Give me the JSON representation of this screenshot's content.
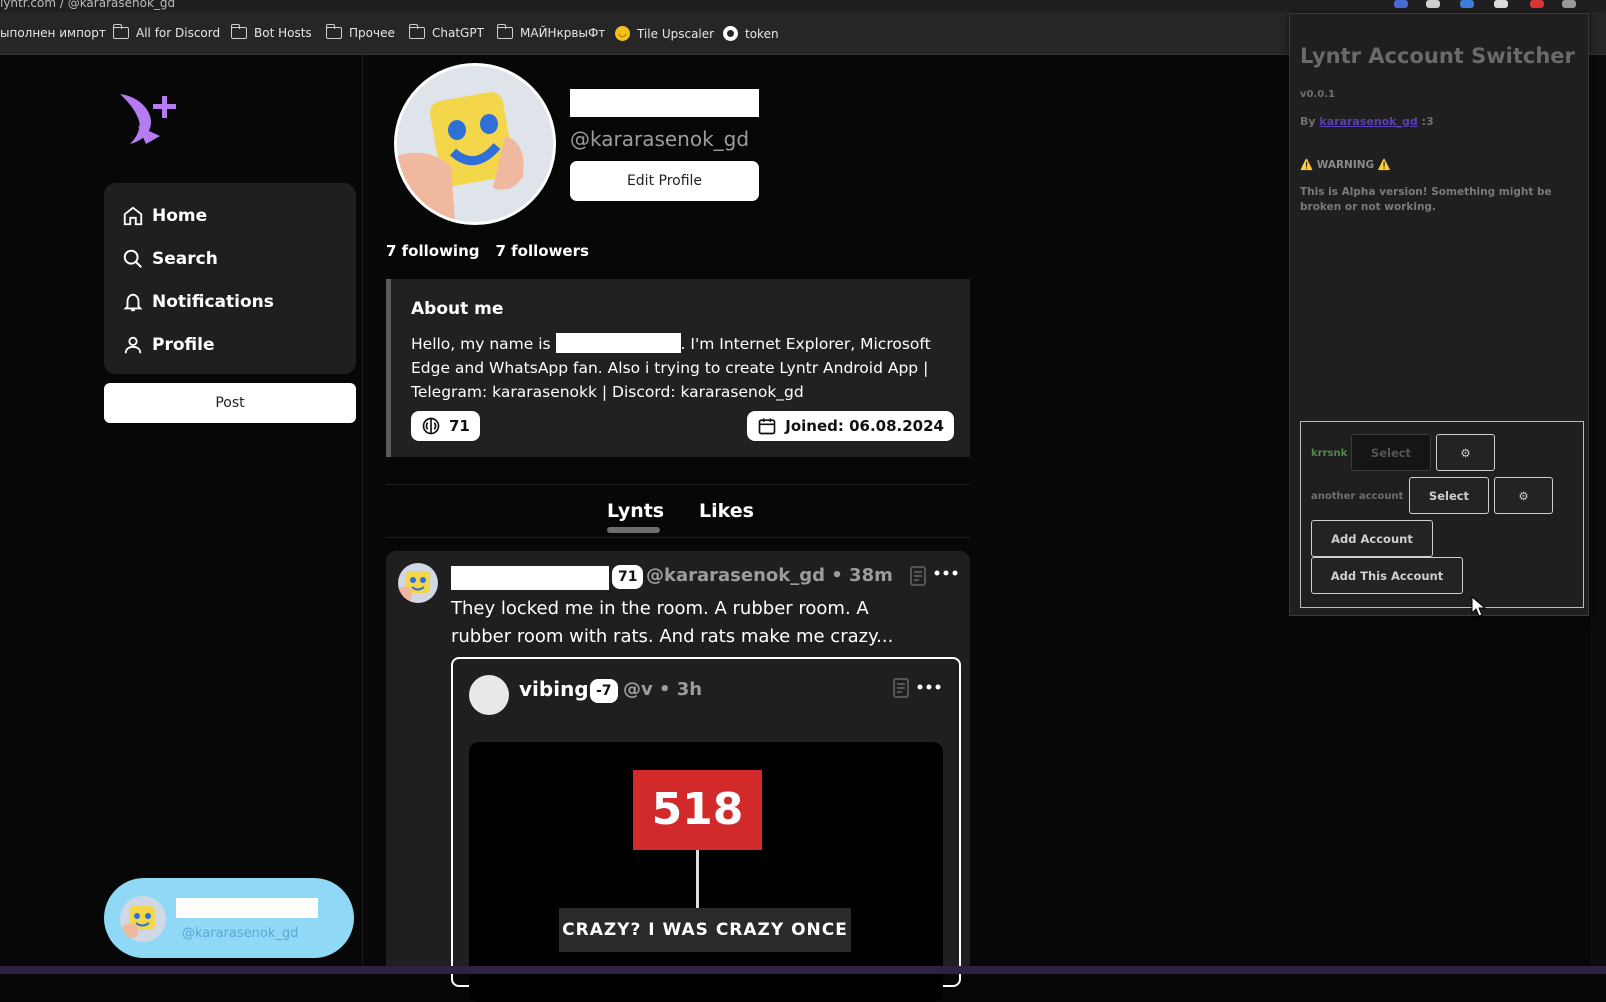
{
  "browser": {
    "tab_title": "lyntr.com / @kararasenok_gd",
    "bookmarks": [
      {
        "label": "ыполнен импорт",
        "icon": "none"
      },
      {
        "label": "All for Discord",
        "icon": "folder-icon"
      },
      {
        "label": "Bot Hosts",
        "icon": "folder-icon"
      },
      {
        "label": "Прочее",
        "icon": "folder-icon"
      },
      {
        "label": "ChatGPT",
        "icon": "folder-icon"
      },
      {
        "label": "МАЙНкрвыФт",
        "icon": "folder-icon"
      },
      {
        "label": "Tile Upscaler",
        "icon": "emoji-icon"
      },
      {
        "label": "token",
        "icon": "globe-icon"
      }
    ]
  },
  "sidebar": {
    "nav": [
      {
        "label": "Home",
        "icon": "home-icon"
      },
      {
        "label": "Search",
        "icon": "search-icon"
      },
      {
        "label": "Notifications",
        "icon": "bell-icon"
      },
      {
        "label": "Profile",
        "icon": "user-icon"
      }
    ],
    "post_label": "Post",
    "account_handle": "@kararasenok_gd"
  },
  "profile": {
    "handle": "@kararasenok_gd",
    "edit_label": "Edit Profile",
    "following": "7 following",
    "followers": "7 followers",
    "about_title": "About me",
    "about_prefix": "Hello, my name is",
    "about_suffix": ". I'm Internet Explorer, Microsoft Edge and WhatsApp fan. Also i trying to create Lyntr Android App | Telegram: kararasenokk | Discord: kararasenok_gd",
    "aura": "71",
    "joined": "Joined: 06.08.2024"
  },
  "tabs": [
    {
      "label": "Lynts",
      "active": true
    },
    {
      "label": "Likes",
      "active": false
    }
  ],
  "post": {
    "aura": "71",
    "meta": "@kararasenok_gd • 38m",
    "text": "They locked me in the room. A rubber room. A rubber room with rats. And rats make me crazy...",
    "quote": {
      "name": "vibing",
      "aura": "-7",
      "meta": "@v • 3h",
      "meme_number": "518",
      "meme_caption": "CRAZY? I WAS CRAZY ONCE"
    }
  },
  "extension": {
    "title": "Lyntr Account Switcher",
    "version": "v0.0.1",
    "by_prefix": "By",
    "author": "kararasenok_gd",
    "by_suffix": ":3",
    "warning": "⚠️ WARNING ⚠️",
    "warning_text": "This is Alpha version! Something might be broken or not working.",
    "accounts": [
      {
        "name": "krrsnk",
        "select_label": "Select",
        "active": true,
        "color": "#4f8a4f"
      },
      {
        "name": "another account",
        "select_label": "Select",
        "active": false,
        "color": "#6f6f6f"
      }
    ],
    "add_account_label": "Add Account",
    "add_this_account_label": "Add This Account"
  },
  "colors": {
    "accent_purple": "#b57bf0",
    "pill_blue": "#8fd9f7",
    "meme_red": "#d2292a"
  }
}
